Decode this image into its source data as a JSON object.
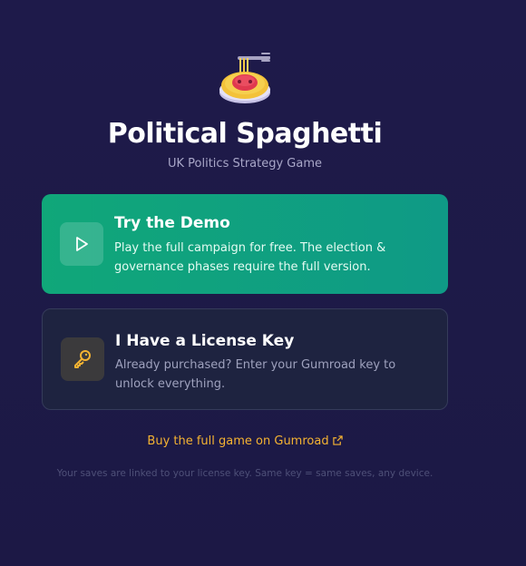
{
  "app": {
    "title": "Political Spaghetti",
    "subtitle": "UK Politics Strategy Game",
    "logo_icon": "spaghetti-bowl-icon"
  },
  "cards": {
    "demo": {
      "title": "Try the Demo",
      "description": "Play the full campaign for free. The election & governance phases require the full version.",
      "icon": "play-icon",
      "color": "#10a779"
    },
    "license": {
      "title": "I Have a License Key",
      "description": "Already purchased? Enter your Gumroad key to unlock everything.",
      "icon": "key-icon",
      "icon_color": "#f5b332"
    }
  },
  "buy_link": {
    "label": "Buy the full game on Gumroad",
    "icon": "external-link-icon",
    "color": "#f5b332"
  },
  "footnote": "Your saves are linked to your license key. Same key = same saves, any device."
}
